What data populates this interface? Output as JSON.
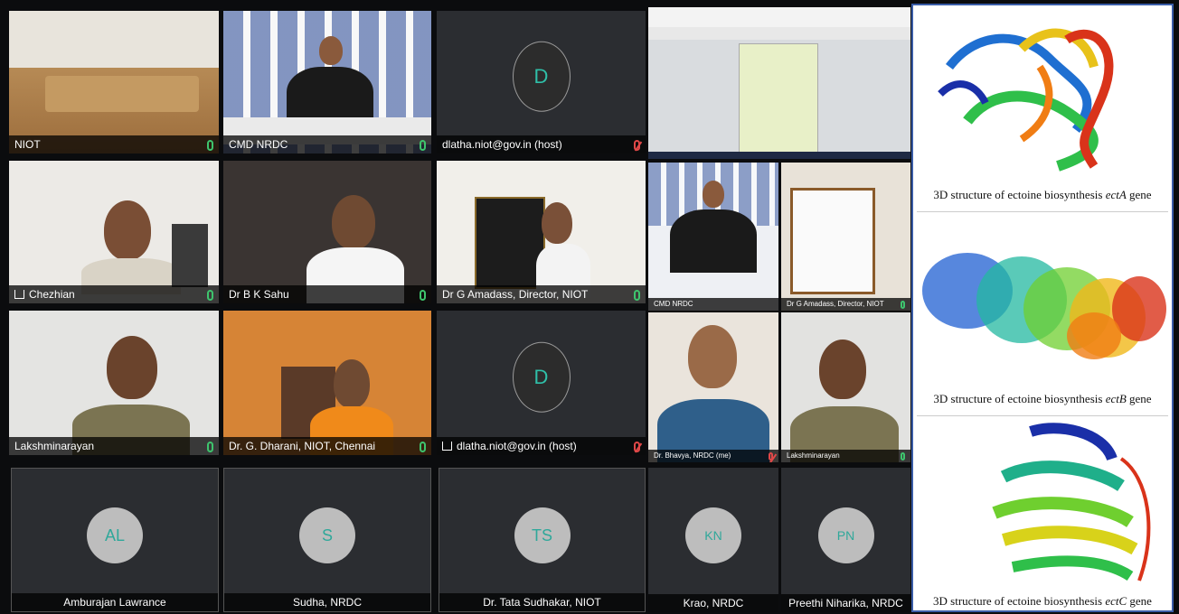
{
  "tiles": {
    "niot": "NIOT",
    "cmd_nrdc": "CMD NRDC",
    "dlatha_host_1": "dlatha.niot@gov.in (host)",
    "dlatha_avatar_1": "D",
    "chezhian": "Chezhian",
    "bk_sahu": "Dr B K Sahu",
    "amadass": "Dr G Amadass, Director, NIOT",
    "cmd_nrdc_small": "CMD NRDC",
    "amadass_small": "Dr G Amadass, Director, NIOT",
    "lakshminarayan": "Lakshminarayan",
    "dharani": "Dr. G. Dharani, NIOT, Chennai",
    "dlatha_host_2": "dlatha.niot@gov.in (host)",
    "dlatha_avatar_2": "D",
    "bhavya_small": "Dr. Bhavya, NRDC (me)",
    "lakshminarayan_small": "Lakshminarayan",
    "amburajan": "Amburajan Lawrance",
    "amburajan_avatar": "AL",
    "sudha": "Sudha, NRDC",
    "sudha_avatar": "S",
    "tata": "Dr. Tata Sudhakar, NIOT",
    "tata_avatar": "TS",
    "krao": "Krao, NRDC",
    "krao_avatar": "KN",
    "preethi": "Preethi Niharika, NRDC",
    "preethi_avatar": "PN"
  },
  "panel": {
    "captions": [
      {
        "prefix": "3D structure of ectoine biosynthesis ",
        "gene": "ectA",
        "suffix": " gene"
      },
      {
        "prefix": "3D structure of ectoine biosynthesis ",
        "gene": "ectB",
        "suffix": " gene"
      },
      {
        "prefix": "3D structure of ectoine biosynthesis ",
        "gene": "ectC",
        "suffix": " gene"
      }
    ]
  },
  "colors": {
    "mic_on": "#3ec46d",
    "mic_off": "#e04848",
    "avatar_bg": "#bdbdbd",
    "avatar_text": "#2fa89a",
    "panel_border": "#3a5da8"
  }
}
